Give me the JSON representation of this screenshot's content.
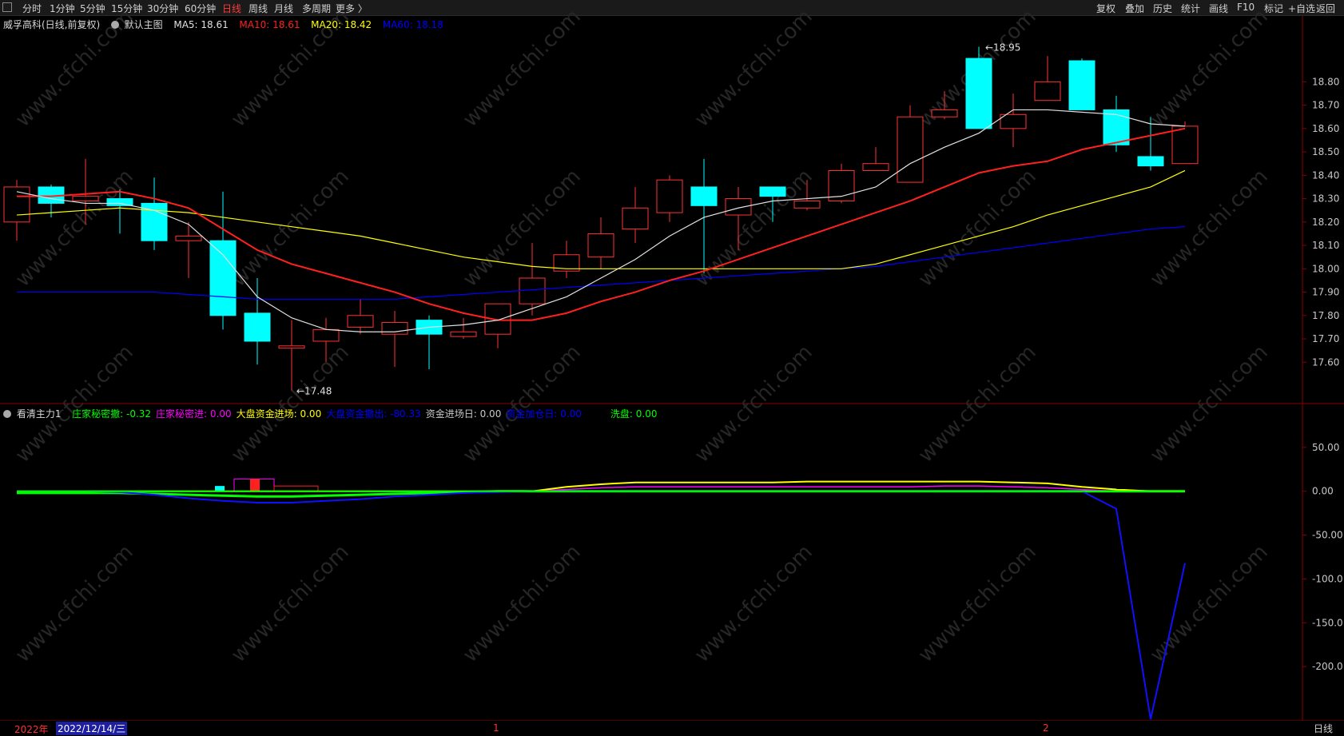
{
  "toolbar": {
    "periods": [
      "分时",
      "1分钟",
      "5分钟",
      "15分钟",
      "30分钟",
      "60分钟",
      "日线",
      "周线",
      "月线",
      "多周期",
      "更多 〉"
    ],
    "active_period": "日线",
    "tools": [
      "复权",
      "叠加",
      "历史",
      "统计",
      "画线",
      "F10",
      "标记",
      "+自选",
      "返回"
    ]
  },
  "main_header": {
    "stock": "威孚高科(日线,前复权)",
    "template": "默认主图",
    "ma5": "MA5: 18.61",
    "ma10": "MA10: 18.61",
    "ma20": "MA20: 18.42",
    "ma60": "MA60: 18.18"
  },
  "indicator_header": {
    "name": "看清主力1",
    "items": [
      {
        "text": "庄家秘密撤: -0.32",
        "color": "#00ff00"
      },
      {
        "text": "庄家秘密进: 0.00",
        "color": "#ff00ff"
      },
      {
        "text": "大盘资金进场: 0.00",
        "color": "#ffff00"
      },
      {
        "text": "大盘资金撤出: -80.33",
        "color": "#0000ff"
      },
      {
        "text": "资金进场日: 0.00",
        "color": "#c8c8c8"
      },
      {
        "text": "资金加仓日: 0.00",
        "color": "#0000ff"
      },
      {
        "text": "洗盘: 0.00",
        "color": "#00ff00"
      }
    ]
  },
  "price_axis": [
    "18.80",
    "18.70",
    "18.60",
    "18.50",
    "18.40",
    "18.30",
    "18.20",
    "18.10",
    "18.00",
    "17.90",
    "17.80",
    "17.70",
    "17.60"
  ],
  "indicator_axis": [
    "50.00",
    "0.00",
    "-50.00",
    "-100.0",
    "-150.0",
    "-200.0"
  ],
  "bottom_bar": {
    "year": "2022年",
    "date": "2022/12/14/三",
    "month_1": "1",
    "month_2": "2",
    "period_label": "日线"
  },
  "annotations": {
    "high": "18.95",
    "low": "17.48"
  },
  "watermark": "www.cfchi.com",
  "colors": {
    "up": "#ff3232",
    "down": "#00ffff",
    "ma5": "#e0e0e0",
    "ma10": "#ff2020",
    "ma20": "#ffff00",
    "ma60": "#0000ff",
    "grid": "#8b0000"
  },
  "chart_data": {
    "type": "candlestick",
    "ylim": [
      17.43,
      19.02
    ],
    "candles": [
      {
        "o": 18.2,
        "h": 18.38,
        "l": 18.12,
        "c": 18.35
      },
      {
        "o": 18.35,
        "h": 18.36,
        "l": 18.22,
        "c": 18.28
      },
      {
        "o": 18.29,
        "h": 18.47,
        "l": 18.19,
        "c": 18.31
      },
      {
        "o": 18.3,
        "h": 18.34,
        "l": 18.15,
        "c": 18.27
      },
      {
        "o": 18.28,
        "h": 18.39,
        "l": 18.08,
        "c": 18.12
      },
      {
        "o": 18.12,
        "h": 18.2,
        "l": 17.96,
        "c": 18.14
      },
      {
        "o": 18.12,
        "h": 18.33,
        "l": 17.74,
        "c": 17.8
      },
      {
        "o": 17.81,
        "h": 17.96,
        "l": 17.59,
        "c": 17.69
      },
      {
        "o": 17.66,
        "h": 17.78,
        "l": 17.48,
        "c": 17.67
      },
      {
        "o": 17.69,
        "h": 17.79,
        "l": 17.6,
        "c": 17.74
      },
      {
        "o": 17.75,
        "h": 17.87,
        "l": 17.72,
        "c": 17.8
      },
      {
        "o": 17.72,
        "h": 17.82,
        "l": 17.58,
        "c": 17.77
      },
      {
        "o": 17.78,
        "h": 17.8,
        "l": 17.57,
        "c": 17.72
      },
      {
        "o": 17.71,
        "h": 17.79,
        "l": 17.7,
        "c": 17.73
      },
      {
        "o": 17.72,
        "h": 17.84,
        "l": 17.66,
        "c": 17.85
      },
      {
        "o": 17.85,
        "h": 18.11,
        "l": 17.8,
        "c": 17.96
      },
      {
        "o": 17.99,
        "h": 18.12,
        "l": 17.96,
        "c": 18.06
      },
      {
        "o": 18.05,
        "h": 18.22,
        "l": 18.0,
        "c": 18.15
      },
      {
        "o": 18.17,
        "h": 18.35,
        "l": 18.11,
        "c": 18.26
      },
      {
        "o": 18.24,
        "h": 18.4,
        "l": 18.2,
        "c": 18.38
      },
      {
        "o": 18.35,
        "h": 18.47,
        "l": 17.98,
        "c": 18.27
      },
      {
        "o": 18.23,
        "h": 18.35,
        "l": 18.08,
        "c": 18.3
      },
      {
        "o": 18.35,
        "h": 18.35,
        "l": 18.2,
        "c": 18.31
      },
      {
        "o": 18.26,
        "h": 18.38,
        "l": 18.25,
        "c": 18.29
      },
      {
        "o": 18.29,
        "h": 18.45,
        "l": 18.28,
        "c": 18.42
      },
      {
        "o": 18.42,
        "h": 18.52,
        "l": 18.43,
        "c": 18.45
      },
      {
        "o": 18.37,
        "h": 18.7,
        "l": 18.37,
        "c": 18.65
      },
      {
        "o": 18.65,
        "h": 18.76,
        "l": 18.64,
        "c": 18.68
      },
      {
        "o": 18.9,
        "h": 18.95,
        "l": 18.6,
        "c": 18.6
      },
      {
        "o": 18.6,
        "h": 18.75,
        "l": 18.52,
        "c": 18.66
      },
      {
        "o": 18.72,
        "h": 18.91,
        "l": 18.72,
        "c": 18.8
      },
      {
        "o": 18.89,
        "h": 18.9,
        "l": 18.68,
        "c": 18.68
      },
      {
        "o": 18.68,
        "h": 18.74,
        "l": 18.5,
        "c": 18.53
      },
      {
        "o": 18.48,
        "h": 18.65,
        "l": 18.42,
        "c": 18.44
      },
      {
        "o": 18.45,
        "h": 18.63,
        "l": 18.45,
        "c": 18.61
      }
    ],
    "ma5": [
      18.33,
      18.3,
      18.28,
      18.28,
      18.25,
      18.19,
      18.06,
      17.88,
      17.79,
      17.74,
      17.73,
      17.73,
      17.75,
      17.76,
      17.78,
      17.83,
      17.88,
      17.96,
      18.04,
      18.14,
      18.22,
      18.26,
      18.29,
      18.3,
      18.31,
      18.35,
      18.45,
      18.52,
      18.58,
      18.68,
      18.68,
      18.67,
      18.66,
      18.62,
      18.61
    ],
    "ma10": [
      18.31,
      18.31,
      18.32,
      18.33,
      18.3,
      18.26,
      18.17,
      18.08,
      18.02,
      17.98,
      17.94,
      17.9,
      17.85,
      17.81,
      17.78,
      17.78,
      17.81,
      17.86,
      17.9,
      17.95,
      17.99,
      18.04,
      18.09,
      18.14,
      18.19,
      18.24,
      18.29,
      18.35,
      18.41,
      18.44,
      18.46,
      18.51,
      18.54,
      18.57,
      18.6
    ],
    "ma20": [
      18.23,
      18.24,
      18.25,
      18.26,
      18.25,
      18.24,
      18.22,
      18.2,
      18.18,
      18.16,
      18.14,
      18.11,
      18.08,
      18.05,
      18.03,
      18.01,
      18.0,
      18.0,
      18.0,
      18.0,
      18.0,
      18.0,
      18.0,
      18.0,
      18.0,
      18.02,
      18.06,
      18.1,
      18.14,
      18.18,
      18.23,
      18.27,
      18.31,
      18.35,
      18.42
    ],
    "ma60": [
      17.9,
      17.9,
      17.9,
      17.9,
      17.9,
      17.89,
      17.88,
      17.87,
      17.87,
      17.87,
      17.87,
      17.87,
      17.88,
      17.89,
      17.9,
      17.91,
      17.92,
      17.93,
      17.94,
      17.95,
      17.96,
      17.97,
      17.98,
      17.99,
      18.0,
      18.01,
      18.03,
      18.05,
      18.07,
      18.09,
      18.11,
      18.13,
      18.15,
      18.17,
      18.18
    ],
    "indicator": {
      "ylim": [
        -260,
        100
      ],
      "yellow": [
        0,
        0,
        0,
        0,
        0,
        0,
        0,
        0,
        0,
        0,
        0,
        0,
        0,
        0,
        0,
        0,
        5,
        8,
        10,
        10,
        10,
        10,
        10,
        11,
        11,
        11,
        11,
        11,
        11,
        10,
        9,
        5,
        2,
        0,
        0
      ],
      "magenta": [
        0,
        0,
        0,
        0,
        0,
        0,
        0,
        0,
        0,
        0,
        0,
        0,
        0,
        0,
        0,
        0,
        2,
        4,
        5,
        5,
        5,
        5,
        5,
        5,
        5,
        5,
        5,
        6,
        6,
        5,
        4,
        2,
        0,
        0,
        0
      ],
      "green": [
        -2,
        -2,
        -2,
        -2,
        -3,
        -4,
        -5,
        -6,
        -6,
        -5,
        -4,
        -3,
        -2,
        -1,
        0,
        0,
        0,
        0,
        0,
        0,
        0,
        0,
        0,
        0,
        0,
        0,
        0,
        0,
        0,
        0,
        0,
        0,
        0,
        0,
        0
      ],
      "blue": [
        0,
        0,
        0,
        -1,
        -4,
        -8,
        -11,
        -13,
        -13,
        -11,
        -9,
        -6,
        -4,
        -2,
        -1,
        0,
        0,
        0,
        0,
        0,
        0,
        0,
        0,
        0,
        0,
        0,
        0,
        0,
        0,
        0,
        0,
        0,
        -20,
        -260,
        -82
      ]
    }
  }
}
